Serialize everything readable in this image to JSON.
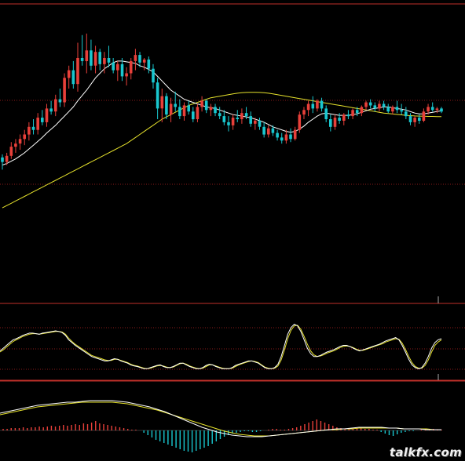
{
  "watermark": "talkfx.com",
  "colors": {
    "background": "#000000",
    "up": "#e8403a",
    "down": "#19c7cf",
    "fast_ma": "#ffffff",
    "slow_ma": "#e6e22c",
    "grid": "#8a1a1a",
    "frame": "#c0302a"
  },
  "chart_data": [
    {
      "panel": "price",
      "type": "candlestick",
      "ylim": [
        0,
        100
      ],
      "grid": true,
      "candles": [
        [
          15,
          17,
          7,
          12
        ],
        [
          12,
          18,
          10,
          16
        ],
        [
          16,
          25,
          14,
          22
        ],
        [
          22,
          27,
          18,
          24
        ],
        [
          24,
          30,
          20,
          27
        ],
        [
          27,
          33,
          23,
          30
        ],
        [
          30,
          38,
          26,
          35
        ],
        [
          35,
          40,
          30,
          33
        ],
        [
          33,
          44,
          30,
          41
        ],
        [
          41,
          46,
          36,
          38
        ],
        [
          38,
          50,
          35,
          47
        ],
        [
          47,
          52,
          43,
          45
        ],
        [
          45,
          56,
          42,
          53
        ],
        [
          53,
          60,
          48,
          51
        ],
        [
          51,
          70,
          48,
          67
        ],
        [
          67,
          75,
          60,
          72
        ],
        [
          72,
          78,
          60,
          63
        ],
        [
          63,
          90,
          58,
          80
        ],
        [
          80,
          95,
          75,
          78
        ],
        [
          78,
          96,
          70,
          85
        ],
        [
          85,
          92,
          72,
          75
        ],
        [
          75,
          88,
          70,
          84
        ],
        [
          84,
          86,
          72,
          76
        ],
        [
          76,
          84,
          70,
          80
        ],
        [
          80,
          88,
          74,
          77
        ],
        [
          77,
          80,
          70,
          72
        ],
        [
          72,
          78,
          65,
          76
        ],
        [
          76,
          80,
          65,
          68
        ],
        [
          68,
          74,
          62,
          70
        ],
        [
          70,
          80,
          66,
          78
        ],
        [
          78,
          86,
          72,
          82
        ],
        [
          82,
          84,
          74,
          77
        ],
        [
          77,
          80,
          72,
          79
        ],
        [
          79,
          81,
          70,
          73
        ],
        [
          73,
          76,
          60,
          64
        ],
        [
          64,
          67,
          40,
          47
        ],
        [
          47,
          60,
          38,
          55
        ],
        [
          55,
          57,
          40,
          43
        ],
        [
          43,
          54,
          38,
          50
        ],
        [
          50,
          58,
          45,
          48
        ],
        [
          48,
          53,
          40,
          42
        ],
        [
          42,
          51,
          39,
          49
        ],
        [
          49,
          52,
          43,
          45
        ],
        [
          45,
          48,
          38,
          40
        ],
        [
          40,
          50,
          38,
          48
        ],
        [
          48,
          55,
          45,
          52
        ],
        [
          52,
          53,
          44,
          46
        ],
        [
          46,
          50,
          42,
          48
        ],
        [
          48,
          50,
          42,
          44
        ],
        [
          44,
          48,
          40,
          42
        ],
        [
          42,
          46,
          36,
          38
        ],
        [
          38,
          42,
          32,
          36
        ],
        [
          36,
          43,
          33,
          41
        ],
        [
          41,
          46,
          38,
          40
        ],
        [
          40,
          47,
          37,
          44
        ],
        [
          44,
          48,
          40,
          42
        ],
        [
          42,
          45,
          35,
          37
        ],
        [
          37,
          41,
          33,
          39
        ],
        [
          39,
          41,
          33,
          35
        ],
        [
          35,
          38,
          28,
          30
        ],
        [
          30,
          36,
          28,
          34
        ],
        [
          34,
          36,
          29,
          31
        ],
        [
          31,
          33,
          26,
          28
        ],
        [
          28,
          31,
          24,
          26
        ],
        [
          26,
          33,
          24,
          30
        ],
        [
          30,
          34,
          25,
          27
        ],
        [
          27,
          35,
          26,
          33
        ],
        [
          33,
          45,
          31,
          43
        ],
        [
          43,
          48,
          40,
          46
        ],
        [
          46,
          52,
          42,
          50
        ],
        [
          50,
          55,
          44,
          47
        ],
        [
          47,
          53,
          45,
          52
        ],
        [
          52,
          54,
          45,
          47
        ],
        [
          47,
          49,
          38,
          40
        ],
        [
          40,
          43,
          32,
          35
        ],
        [
          35,
          43,
          33,
          41
        ],
        [
          41,
          44,
          37,
          39
        ],
        [
          39,
          44,
          36,
          43
        ],
        [
          43,
          46,
          40,
          42
        ],
        [
          42,
          47,
          40,
          46
        ],
        [
          46,
          48,
          42,
          44
        ],
        [
          44,
          49,
          42,
          48
        ],
        [
          48,
          52,
          46,
          51
        ],
        [
          51,
          53,
          47,
          49
        ],
        [
          49,
          51,
          45,
          47
        ],
        [
          47,
          52,
          45,
          50
        ],
        [
          50,
          52,
          46,
          48
        ],
        [
          48,
          50,
          44,
          45
        ],
        [
          45,
          49,
          43,
          48
        ],
        [
          48,
          52,
          44,
          46
        ],
        [
          46,
          50,
          43,
          45
        ],
        [
          45,
          48,
          40,
          42
        ],
        [
          42,
          44,
          36,
          38
        ],
        [
          38,
          42,
          35,
          41
        ],
        [
          41,
          43,
          37,
          39
        ],
        [
          39,
          47,
          38,
          45
        ],
        [
          45,
          50,
          43,
          48
        ],
        [
          48,
          51,
          45,
          46
        ],
        [
          46,
          48,
          44,
          47
        ],
        [
          47,
          48,
          44,
          45
        ]
      ],
      "ma_fast": [
        10,
        11,
        12.5,
        14,
        16,
        18,
        20.5,
        23,
        25.5,
        28,
        31,
        33.5,
        36,
        39,
        42,
        45,
        48,
        52,
        55.5,
        59,
        63,
        67,
        70,
        73,
        75,
        77,
        78,
        78,
        77.5,
        77,
        76.5,
        75,
        74,
        72.5,
        71,
        68,
        65,
        62,
        59,
        57,
        55,
        53,
        52,
        51,
        50,
        49,
        48,
        47.5,
        47,
        46,
        45,
        44,
        43,
        42.5,
        42,
        41.5,
        41,
        40,
        39,
        38,
        36.5,
        35,
        34,
        33,
        32,
        31.5,
        32,
        33.5,
        35.5,
        38,
        40,
        42,
        43.5,
        44,
        43.5,
        43,
        42.5,
        42.5,
        42.5,
        43,
        43.5,
        44.5,
        45.5,
        46.5,
        47,
        47.5,
        48,
        48,
        47.5,
        47,
        46.5,
        46,
        45,
        44,
        43.5,
        43.5,
        44,
        44.5,
        45,
        45.5
      ],
      "ma_slow": [
        -18,
        -16.5,
        -15,
        -13.5,
        -12,
        -10.5,
        -9,
        -7.5,
        -6,
        -4.5,
        -3,
        -1.5,
        0,
        1.5,
        3,
        4.5,
        6,
        7.5,
        9,
        10.5,
        12,
        13.5,
        15,
        16.5,
        18,
        19.5,
        21,
        22.5,
        24,
        26,
        28,
        30,
        32,
        34,
        36,
        38,
        40,
        41.5,
        43,
        44.5,
        46,
        47.5,
        49,
        50,
        51,
        52,
        53,
        54,
        54.5,
        55,
        55.5,
        56,
        56.5,
        57,
        57.3,
        57.5,
        57.6,
        57.6,
        57.5,
        57.3,
        57,
        56.5,
        56,
        55.5,
        55,
        54.5,
        54,
        53.5,
        53,
        52.5,
        52,
        51.5,
        51,
        50.5,
        50,
        49.5,
        49,
        48.5,
        48,
        47.5,
        47,
        46.5,
        46,
        45.5,
        45,
        44.5,
        44,
        43.7,
        43.4,
        43.1,
        42.8,
        42.5,
        42.3,
        42.1,
        42,
        41.9,
        41.8,
        41.8,
        41.7,
        41.7
      ]
    },
    {
      "panel": "oscillator",
      "type": "line",
      "ylim": [
        0,
        100
      ],
      "grid": true,
      "series": [
        {
          "values": [
            40,
            45,
            50,
            55,
            60,
            62,
            65,
            68,
            70,
            72,
            72,
            71,
            70,
            72,
            73,
            74,
            75,
            76,
            75,
            73,
            68,
            60,
            55,
            50,
            46,
            42,
            38,
            34,
            30,
            28,
            26,
            24,
            22,
            22,
            24,
            26,
            25,
            22,
            20,
            18,
            15,
            13,
            12,
            10,
            8,
            8,
            10,
            12,
            14,
            15,
            12,
            10,
            10,
            12,
            15,
            18,
            18,
            15,
            12,
            10,
            8,
            8,
            10,
            14,
            16,
            15,
            12,
            10,
            8,
            8,
            8,
            10,
            14,
            16,
            18,
            20,
            22,
            22,
            20,
            18,
            14,
            10,
            8,
            8,
            10,
            16,
            30,
            50,
            70,
            82,
            88,
            85,
            75,
            60,
            45,
            35,
            30,
            30,
            32,
            35,
            38,
            40,
            42,
            45,
            48,
            50,
            50,
            48,
            45,
            42,
            40,
            42,
            44,
            46,
            48,
            50,
            52,
            55,
            58,
            60,
            62,
            64,
            60,
            50,
            38,
            25,
            15,
            10,
            8,
            10,
            18,
            30,
            45,
            55,
            60,
            62
          ]
        },
        {
          "values": [
            38,
            42,
            47,
            52,
            57,
            60,
            63,
            66,
            68,
            70,
            71,
            71,
            70,
            71,
            72,
            73,
            74,
            75,
            75,
            74,
            70,
            63,
            57,
            52,
            48,
            44,
            40,
            36,
            32,
            30,
            28,
            26,
            24,
            23,
            23,
            25,
            25,
            23,
            21,
            19,
            16,
            14,
            13,
            11,
            9,
            8,
            9,
            11,
            13,
            14,
            13,
            11,
            10,
            11,
            14,
            17,
            18,
            16,
            13,
            11,
            9,
            8,
            9,
            12,
            15,
            15,
            13,
            11,
            9,
            8,
            8,
            9,
            12,
            15,
            17,
            19,
            21,
            22,
            21,
            19,
            15,
            11,
            9,
            8,
            9,
            13,
            24,
            42,
            62,
            77,
            85,
            86,
            79,
            66,
            52,
            40,
            33,
            30,
            31,
            33,
            36,
            38,
            40,
            43,
            46,
            48,
            49,
            48,
            46,
            43,
            41,
            41,
            43,
            45,
            47,
            49,
            51,
            53,
            56,
            58,
            60,
            62,
            61,
            54,
            43,
            30,
            19,
            12,
            9,
            9,
            14,
            24,
            38,
            50,
            56,
            60
          ]
        }
      ]
    },
    {
      "panel": "macd",
      "type": "bar+line",
      "zero_line": true,
      "histogram": [
        2,
        2,
        3,
        3,
        3,
        4,
        3,
        4,
        4,
        5,
        4,
        5,
        6,
        5,
        6,
        7,
        6,
        7,
        8,
        7,
        9,
        8,
        10,
        12,
        9,
        8,
        7,
        6,
        5,
        4,
        3,
        2,
        1,
        1,
        0,
        -3,
        -6,
        -9,
        -12,
        -14,
        -16,
        -18,
        -20,
        -22,
        -24,
        -26,
        -27,
        -28,
        -26,
        -24,
        -22,
        -20,
        -17,
        -14,
        -11,
        -8,
        -6,
        -4,
        -3,
        -2,
        -1,
        -1,
        -2,
        -2,
        -1,
        0,
        1,
        2,
        2,
        1,
        1,
        2,
        3,
        4,
        6,
        8,
        10,
        12,
        14,
        12,
        10,
        8,
        6,
        4,
        3,
        2,
        2,
        2,
        3,
        3,
        2,
        2,
        1,
        1,
        -2,
        -4,
        -6,
        -7,
        -5,
        -3,
        -2,
        -1,
        -1,
        0,
        1,
        1,
        2,
        2,
        1,
        1
      ],
      "series": [
        {
          "values": [
            22,
            24,
            26,
            28,
            30,
            32,
            33,
            34,
            35,
            36,
            36,
            37,
            38,
            38,
            38,
            38,
            37,
            36,
            34,
            32,
            30,
            27,
            24,
            20,
            16,
            12,
            8,
            4,
            1,
            -2,
            -4,
            -6,
            -7,
            -8,
            -8,
            -8,
            -7,
            -6,
            -5,
            -4,
            -3,
            -2,
            -1,
            0,
            1,
            2,
            2,
            3,
            4,
            4,
            4,
            4,
            3,
            3,
            2,
            2,
            2,
            1,
            1,
            1
          ]
        },
        {
          "values": [
            20,
            22,
            24,
            26,
            28,
            30,
            31,
            32,
            33,
            34,
            35,
            36,
            36,
            36,
            36,
            36,
            35,
            34,
            32,
            30,
            28,
            26,
            23,
            20,
            17,
            14,
            11,
            8,
            5,
            2,
            -1,
            -3,
            -5,
            -6,
            -7,
            -7,
            -7,
            -6,
            -5,
            -4,
            -3,
            -2,
            -1,
            0,
            1,
            1,
            2,
            2,
            3,
            3,
            3,
            3,
            3,
            3,
            2,
            2,
            2,
            2,
            1,
            1
          ]
        }
      ]
    }
  ]
}
